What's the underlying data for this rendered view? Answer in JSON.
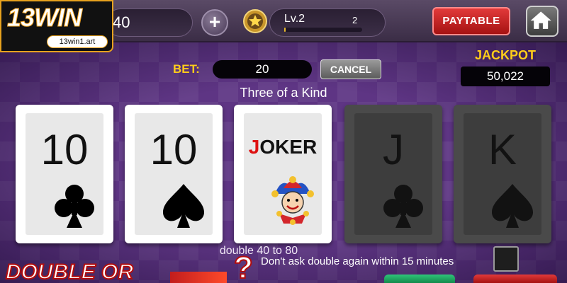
{
  "branding": {
    "logo_text": "13WIN",
    "url_text": "13win1.art"
  },
  "top_bar": {
    "coins": "40",
    "level_label": "Lv.2",
    "level_count": "2",
    "level_progress": 0.02,
    "paytable_label": "PAYTABLE",
    "icons": [
      "plus-icon",
      "star-badge-icon",
      "home-icon"
    ]
  },
  "bet": {
    "label": "BET:",
    "value": "20",
    "cancel_label": "CANCEL"
  },
  "jackpot": {
    "title": "JACKPOT",
    "value": "50,022"
  },
  "hand_result": "Three of a Kind",
  "cards": [
    {
      "rank": "10",
      "suit": "clubs",
      "held": true
    },
    {
      "rank": "10",
      "suit": "spades",
      "held": true
    },
    {
      "rank": "JOKER",
      "suit": "joker",
      "held": true
    },
    {
      "rank": "J",
      "suit": "clubs",
      "held": false
    },
    {
      "rank": "K",
      "suit": "spades",
      "held": false
    }
  ],
  "double": {
    "info": "double 40 to 80",
    "dont_ask_label": "Don't ask double again within 15 minutes",
    "dont_ask_checked": false,
    "banner_text": "DOUBLE OR",
    "banner_question": "?"
  },
  "colors": {
    "accent_gold": "#ffcc1a",
    "paytable_red": "#c51f1f",
    "bg_purple": "#5e3584"
  }
}
